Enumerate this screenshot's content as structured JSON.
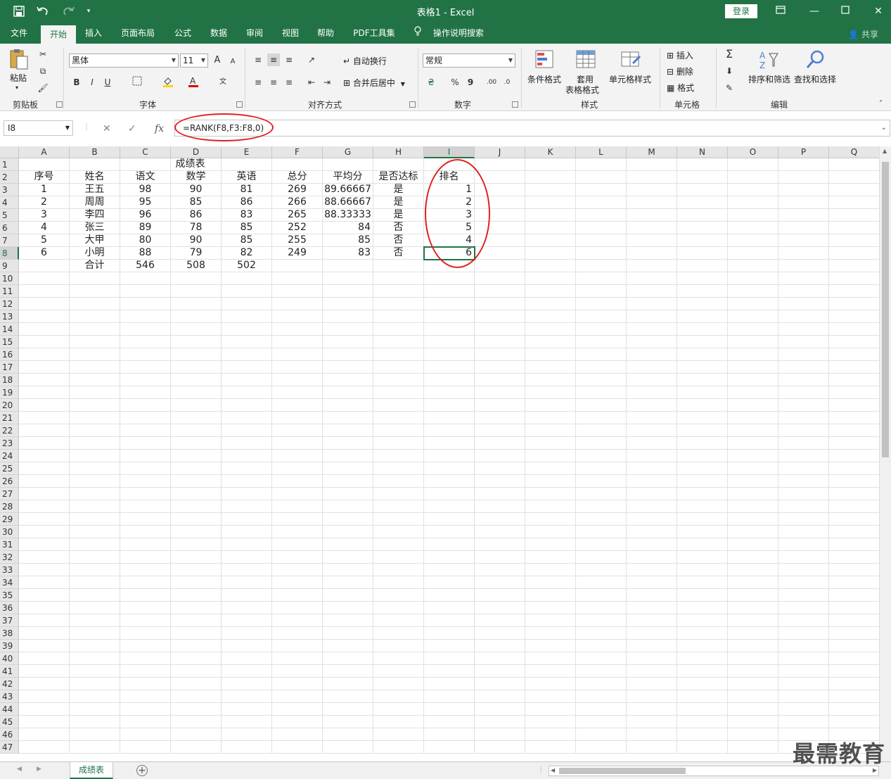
{
  "title_bar": {
    "title": "表格1 - Excel",
    "login_label": "登录",
    "quick_access": [
      "save-icon",
      "undo-icon",
      "redo-icon",
      "customize-icon"
    ],
    "window_buttons": [
      "ribbon-display-icon",
      "minimize-icon",
      "maximize-icon",
      "close-icon"
    ]
  },
  "tabs": [
    "文件",
    "开始",
    "插入",
    "页面布局",
    "公式",
    "数据",
    "审阅",
    "视图",
    "帮助",
    "PDF工具集",
    "操作说明搜索"
  ],
  "active_tab": "开始",
  "share_label": "共享",
  "ribbon": {
    "clipboard": {
      "label": "剪贴板",
      "paste": "粘贴"
    },
    "font": {
      "label": "字体",
      "font_name": "黑体",
      "font_size": "11",
      "bold": "B",
      "italic": "I",
      "underline": "U",
      "grow": "A",
      "shrink": "A",
      "phonetic": "文"
    },
    "alignment": {
      "label": "对齐方式",
      "wrap": "自动换行",
      "merge": "合并后居中"
    },
    "number": {
      "label": "数字",
      "format": "常规",
      "percent": "%",
      "comma": "9"
    },
    "styles": {
      "label": "样式",
      "conditional": "条件格式",
      "table_line1": "套用",
      "table_line2": "表格格式",
      "cell_styles": "单元格样式"
    },
    "cells": {
      "label": "单元格",
      "insert": "插入",
      "delete": "删除",
      "format": "格式"
    },
    "editing": {
      "label": "编辑",
      "sort": "排序和筛选",
      "find": "查找和选择"
    }
  },
  "formula_bar": {
    "name_box": "I8",
    "fx": "fx",
    "formula": "=RANK(F8,F3:F8,0)"
  },
  "columns": [
    "A",
    "B",
    "C",
    "D",
    "E",
    "F",
    "G",
    "H",
    "I",
    "J",
    "K",
    "L",
    "M",
    "N",
    "O",
    "P",
    "Q"
  ],
  "selected_column": "I",
  "selected_row": 8,
  "rows_visible": 47,
  "sheet": {
    "title": "成绩表",
    "headers": [
      "序号",
      "姓名",
      "语文",
      "数学",
      "英语",
      "总分",
      "平均分",
      "是否达标",
      "排名"
    ],
    "rows": [
      [
        "1",
        "王五",
        "98",
        "90",
        "81",
        "269",
        "89.66667",
        "是",
        "1"
      ],
      [
        "2",
        "周周",
        "95",
        "85",
        "86",
        "266",
        "88.66667",
        "是",
        "2"
      ],
      [
        "3",
        "李四",
        "96",
        "86",
        "83",
        "265",
        "88.33333",
        "是",
        "3"
      ],
      [
        "4",
        "张三",
        "89",
        "78",
        "85",
        "252",
        "84",
        "否",
        "5"
      ],
      [
        "5",
        "大甲",
        "80",
        "90",
        "85",
        "255",
        "85",
        "否",
        "4"
      ],
      [
        "6",
        "小明",
        "88",
        "79",
        "82",
        "249",
        "83",
        "否",
        "6"
      ]
    ],
    "totals": [
      "",
      "合计",
      "546",
      "508",
      "502"
    ]
  },
  "sheet_tabs": [
    "成绩表"
  ],
  "watermark": "最需教育"
}
